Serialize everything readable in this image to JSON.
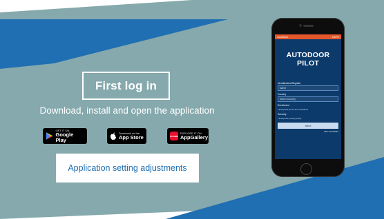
{
  "colors": {
    "teal_background": "#85a9ad",
    "blue_band": "#1f6fb2",
    "cta_text": "#1f6fb2",
    "phone_screen": "#0b3a6b"
  },
  "header": {
    "title": "First log in"
  },
  "subtitle": "Download, install and open the application",
  "store_badges": {
    "google_play": {
      "small": "GET IT ON",
      "big": "Google Play"
    },
    "app_store": {
      "small": "Download on the",
      "big": "App Store"
    },
    "app_gallery": {
      "small": "EXPLORE IT ON",
      "big": "AppGallery",
      "logo_text": "HUAWEI"
    }
  },
  "cta": {
    "label": "Application setting adjustments"
  },
  "phone": {
    "status_left": "vodafone",
    "status_right": "100%",
    "app_title_line1": "AUTODOOR",
    "app_title_line2": "PILOT",
    "field1_label": "Identification/Register",
    "field1_value": "Name",
    "field2_label": "Country",
    "field2_value": "Select Country",
    "field3_label": "Enrollment",
    "field3_note": "I accept the terms and conditions",
    "field4_label": "Security",
    "field4_note": "I accept the privacy policy",
    "button_label": "Save",
    "link_label": "Bus Consultant"
  }
}
